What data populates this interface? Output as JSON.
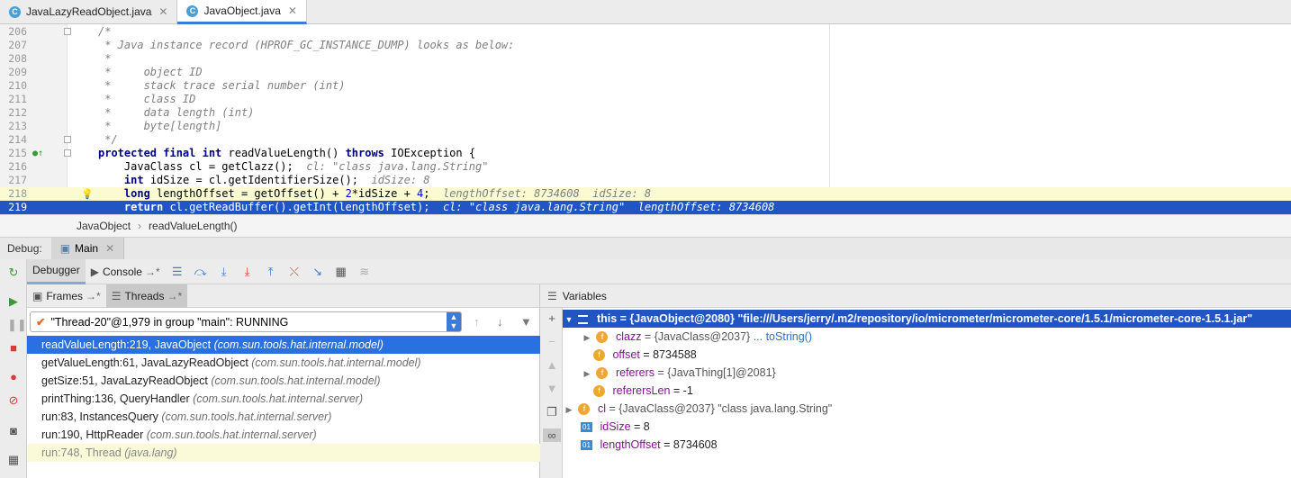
{
  "tabs": [
    {
      "label": "JavaLazyReadObject.java",
      "icon": "C"
    },
    {
      "label": "JavaObject.java",
      "icon": "C"
    }
  ],
  "editor": {
    "lines": [
      {
        "n": "206",
        "html": "<span class=\"cmt\">/*</span>"
      },
      {
        "n": "207",
        "html": "<span class=\"cmt\"> * Java instance record (HPROF_GC_INSTANCE_DUMP) looks as below:</span>"
      },
      {
        "n": "208",
        "html": "<span class=\"cmt\"> *</span>"
      },
      {
        "n": "209",
        "html": "<span class=\"cmt\"> *     object ID</span>"
      },
      {
        "n": "210",
        "html": "<span class=\"cmt\"> *     stack trace serial number (int)</span>"
      },
      {
        "n": "211",
        "html": "<span class=\"cmt\"> *     class ID</span>"
      },
      {
        "n": "212",
        "html": "<span class=\"cmt\"> *     data length (int)</span>"
      },
      {
        "n": "213",
        "html": "<span class=\"cmt\"> *     byte[length]</span>"
      },
      {
        "n": "214",
        "html": "<span class=\"cmt\"> */</span>"
      },
      {
        "n": "215",
        "html": "<span class=\"kw\">protected final int</span> readValueLength() <span class=\"kw\">throws</span> IOException {"
      },
      {
        "n": "216",
        "html": "    JavaClass cl = getClazz();  <span class=\"hint\">cl: \"class java.lang.String\"</span>"
      },
      {
        "n": "217",
        "html": "    <span class=\"kw\">int</span> idSize = cl.getIdentifierSize();  <span class=\"hint\">idSize: 8</span>"
      },
      {
        "n": "218",
        "html": "    <span class=\"kw\">long</span> lengthOffset = getOffset() + <span class=\"num\">2</span>*idSize + <span class=\"num\">4</span>;  <span class=\"hint\">lengthOffset: 8734608  idSize: 8</span>"
      },
      {
        "n": "219",
        "html": "    <span class=\"kw\">return</span> cl.getReadBuffer().getInt(lengthOffset);  <span class=\"hint\">cl: \"class java.lang.String\"  lengthOffset: 8734608</span>"
      }
    ]
  },
  "breadcrumb": {
    "cls": "JavaObject",
    "method": "readValueLength()"
  },
  "debug": {
    "label": "Debug:",
    "session": "Main"
  },
  "toolbar": {
    "debugger": "Debugger",
    "console": "Console"
  },
  "frames": {
    "tab_frames": "Frames",
    "tab_threads": "Threads",
    "thread": "\"Thread-20\"@1,979 in group \"main\": RUNNING",
    "items": [
      {
        "m": "readValueLength:219, JavaObject ",
        "p": "(com.sun.tools.hat.internal.model)"
      },
      {
        "m": "getValueLength:61, JavaLazyReadObject ",
        "p": "(com.sun.tools.hat.internal.model)"
      },
      {
        "m": "getSize:51, JavaLazyReadObject ",
        "p": "(com.sun.tools.hat.internal.model)"
      },
      {
        "m": "printThing:136, QueryHandler ",
        "p": "(com.sun.tools.hat.internal.server)"
      },
      {
        "m": "run:83, InstancesQuery ",
        "p": "(com.sun.tools.hat.internal.server)"
      },
      {
        "m": "run:190, HttpReader ",
        "p": "(com.sun.tools.hat.internal.server)"
      },
      {
        "m": "run:748, Thread ",
        "p": "(java.lang)"
      }
    ]
  },
  "variables": {
    "title": "Variables",
    "this": "this = {JavaObject@2080} \"file:///Users/jerry/.m2/repository/io/micrometer/micrometer-core/1.5.1/micrometer-core-1.5.1.jar\"",
    "clazz_name": "clazz",
    "clazz_val": " = {JavaClass@2037} ",
    "clazz_link": "... toString()",
    "offset_name": "offset",
    "offset_val": " = 8734588",
    "referers_name": "referers",
    "referers_val": " = {JavaThing[1]@2081}",
    "referersLen_name": "referersLen",
    "referersLen_val": " = -1",
    "cl_name": "cl",
    "cl_val": " = {JavaClass@2037} \"class java.lang.String\"",
    "idSize_name": "idSize",
    "idSize_val": " = 8",
    "lengthOffset_name": "lengthOffset",
    "lengthOffset_val": " = 8734608"
  }
}
